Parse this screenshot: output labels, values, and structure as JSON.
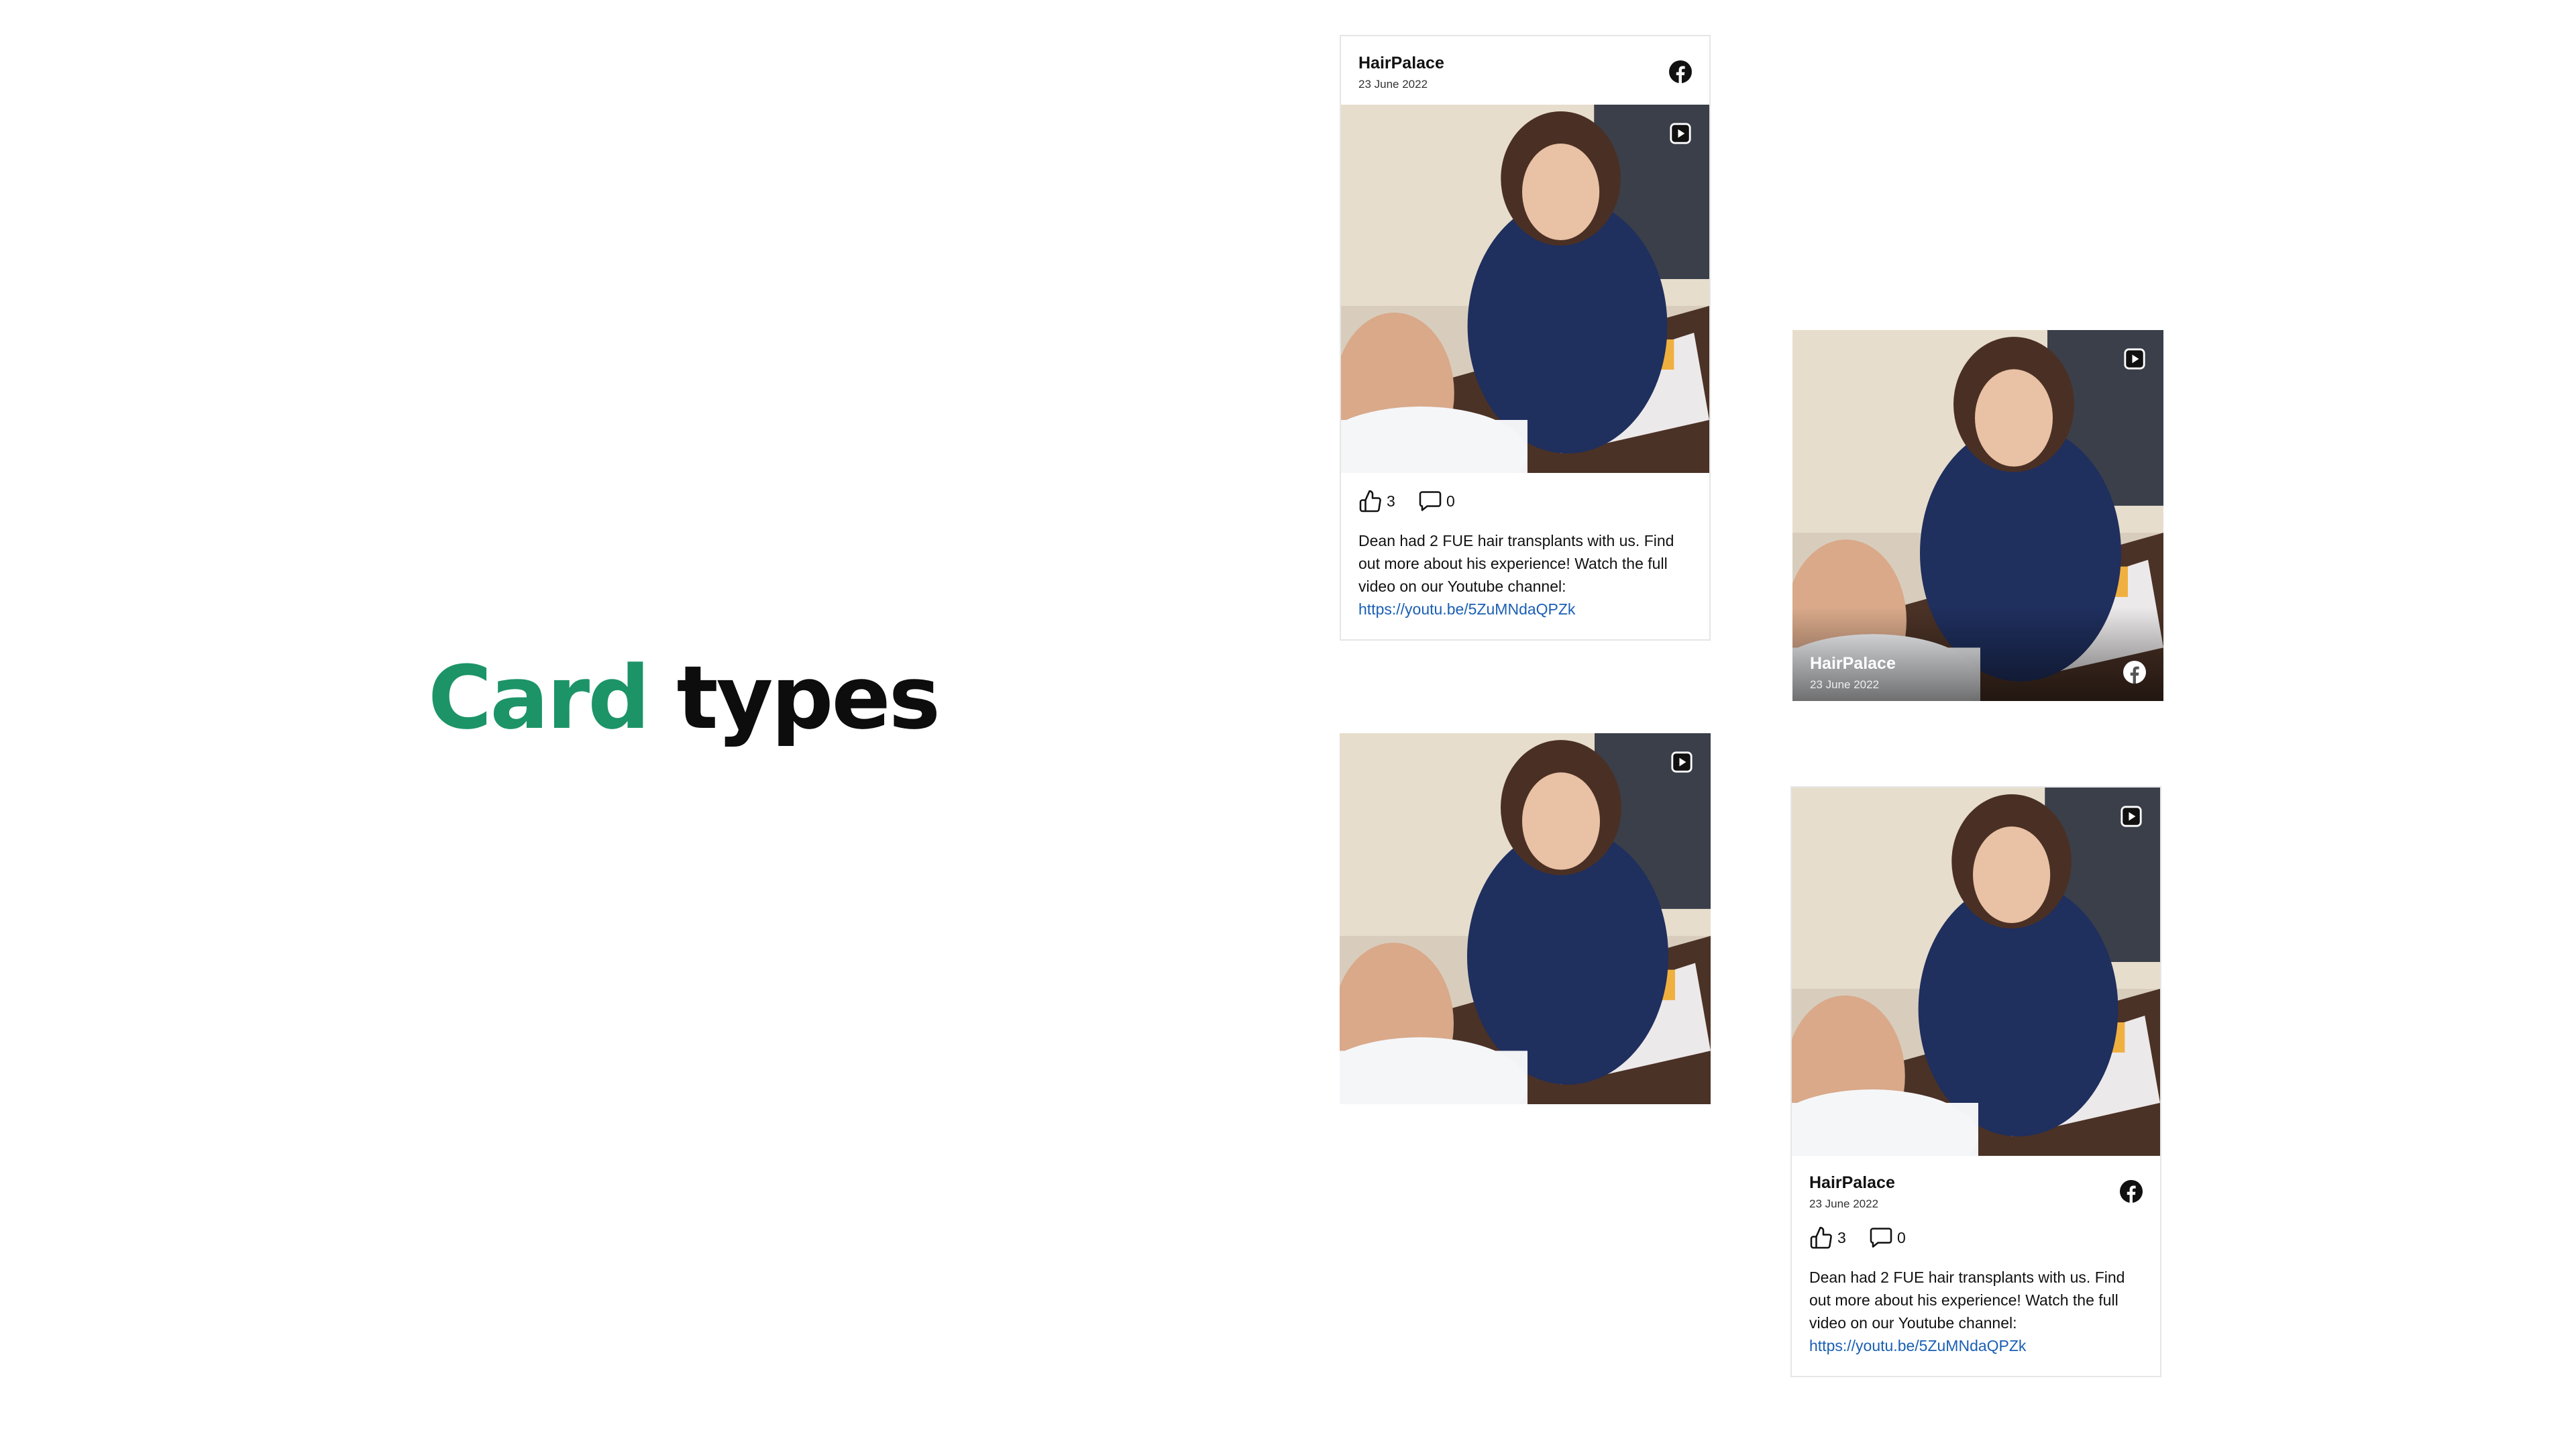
{
  "headline": {
    "word1": "Card",
    "word2": "types"
  },
  "post": {
    "author": "HairPalace",
    "date": "23 June 2022",
    "likes": "3",
    "comments": "0",
    "text": "Dean had 2 FUE hair transplants with us. Find out more about his experience! Watch the full video on our Youtube channel:",
    "link": "https://youtu.be/5ZuMNdaQPZk"
  },
  "icons": {
    "network": "facebook-icon",
    "media_type": "video-play-icon",
    "like": "thumbs-up-icon",
    "comment": "comment-bubble-icon"
  },
  "colors": {
    "accent": "#1c9467",
    "link": "#1a5fb4",
    "text": "#111111"
  }
}
